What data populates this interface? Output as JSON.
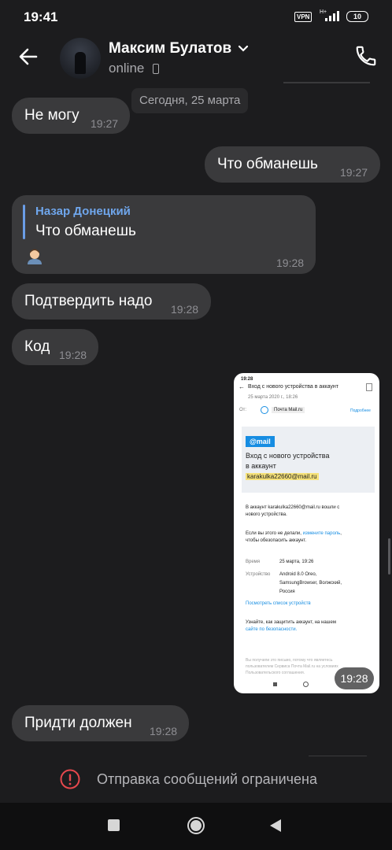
{
  "status_bar": {
    "time": "19:41",
    "vpn": "VPN",
    "battery": "10",
    "network": "H+"
  },
  "header": {
    "contact_name": "Максим Булатов",
    "presence": "online"
  },
  "date_separator": "Сегодня, 25 марта",
  "messages": [
    {
      "text": "Не могу",
      "time": "19:27",
      "direction": "incoming"
    },
    {
      "text": "Что обманешь",
      "time": "19:27",
      "direction": "outgoing"
    },
    {
      "reply_author": "Назар Донецкий",
      "reply_text": "Что обманешь",
      "time": "19:28",
      "direction": "incoming"
    },
    {
      "text": "Подтвердить надо",
      "time": "19:28",
      "direction": "incoming"
    },
    {
      "text": "Код",
      "time": "19:28",
      "direction": "incoming"
    },
    {
      "type": "image",
      "time": "19:28",
      "direction": "incoming"
    },
    {
      "text": "Придти должен",
      "time": "19:28",
      "direction": "incoming"
    }
  ],
  "screenshot_content": {
    "time": "19:28",
    "subject": "Вход с нового устройства в аккаунт",
    "date": "25 марта 2020 г., 18:26",
    "from_label": "От:",
    "sender": "Почта Mail.ru",
    "details_link": "Подробнее",
    "logo": "@mail",
    "headline_line1": "Вход с нового устройства",
    "headline_line2": "в аккаунт",
    "email": "karakulka22660@mail.ru",
    "para1_line1": "В аккаунт karakulka22660@mail.ru вошли с",
    "para1_line2": "нового устройства.",
    "para2_line1_a": "Если вы этого не делали, ",
    "para2_link": "измените пароль",
    "para2_line1_b": ",",
    "para2_line2": "чтобы обезопасить аккаунт.",
    "time_label": "Время",
    "time_value": "25 марта, 19:26",
    "device_label": "Устройство",
    "device_line1": "Android 8.0 Oreo,",
    "device_line2": "SamsungBrowser, Волжский,",
    "device_line3": "Россия",
    "devices_link": "Посмотреть список устройств",
    "protect_line1": "Узнайте, как защитить аккаунт, на нашем",
    "protect_link": "сайте по безопасности.",
    "footer_line1": "Вы получили это письмо, потому что являетесь",
    "footer_line2": "пользователем Сервиса Почта Mail.ru на условиях",
    "footer_line3": "Пользовательского соглашения."
  },
  "footer": {
    "restriction_text": "Отправка сообщений ограничена"
  },
  "colors": {
    "background": "#1c1c1e",
    "bubble": "#3a3a3c",
    "accent": "#6fa6ec",
    "warning": "#e5484d"
  }
}
